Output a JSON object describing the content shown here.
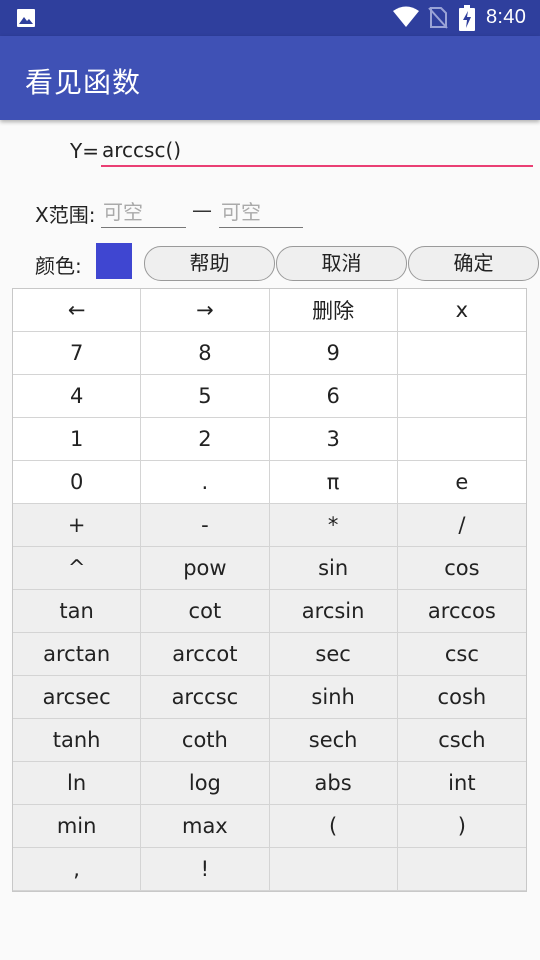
{
  "status_bar": {
    "time": "8:40",
    "icons": [
      "image-icon",
      "wifi-icon",
      "no-sim-icon",
      "battery-charging-icon"
    ]
  },
  "app_bar": {
    "title": "看见函数"
  },
  "form": {
    "y_label": "Y=",
    "y_value": "arccsc()",
    "x_range_label": "X范围:",
    "x_min_placeholder": "可空",
    "x_separator": "—",
    "x_max_placeholder": "可空",
    "color_label": "颜色:",
    "color_value": "#3f46d1"
  },
  "buttons": {
    "help": "帮助",
    "cancel": "取消",
    "ok": "确定"
  },
  "keypad": [
    "←",
    "→",
    "删除",
    "x",
    "7",
    "8",
    "9",
    "",
    "4",
    "5",
    "6",
    "",
    "1",
    "2",
    "3",
    "",
    "0",
    ".",
    "π",
    "e",
    "+",
    "-",
    "*",
    "/",
    "^",
    "pow",
    "sin",
    "cos",
    "tan",
    "cot",
    "arcsin",
    "arccos",
    "arctan",
    "arccot",
    "sec",
    "csc",
    "arcsec",
    "arccsc",
    "sinh",
    "cosh",
    "tanh",
    "coth",
    "sech",
    "csch",
    "ln",
    "log",
    "abs",
    "int",
    "min",
    "max",
    "(",
    ")",
    ",",
    "!",
    "",
    ""
  ]
}
